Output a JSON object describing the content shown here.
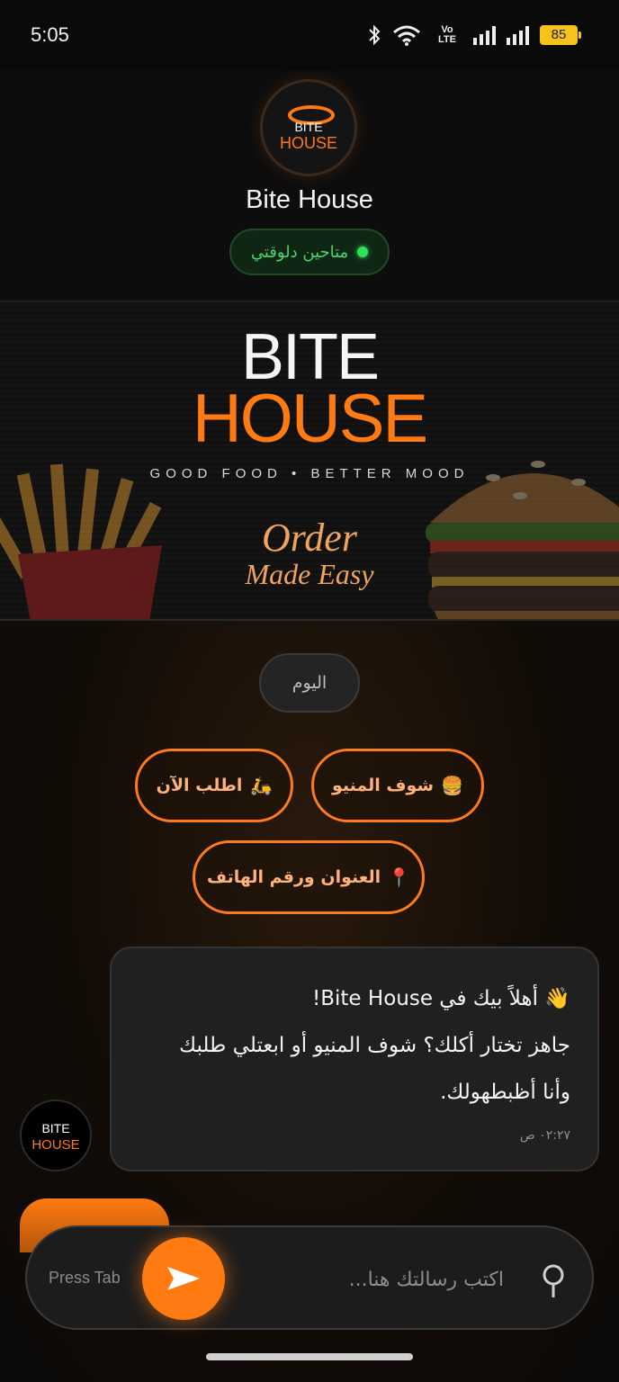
{
  "status_bar": {
    "time": "5:05",
    "network_label": "Vo LTE",
    "battery": "85"
  },
  "header": {
    "logo_top": "BITE",
    "logo_bottom": "HOUSE",
    "name": "Bite House",
    "online_status": "متاحين دلوقتي"
  },
  "banner": {
    "title_top": "BITE",
    "title_bottom": "HOUSE",
    "tagline": "GOOD FOOD • BETTER MOOD",
    "script_line1": "Order",
    "script_line2": "Made Easy"
  },
  "chat": {
    "date_label": "اليوم",
    "quick_replies": [
      {
        "label": "شوف المنيو",
        "icon": "🍔"
      },
      {
        "label": "اطلب الآن",
        "icon": "🛵"
      },
      {
        "label": "العنوان ورقم الهاتف",
        "icon": "📍"
      }
    ],
    "bot_avatar_top": "BITE",
    "bot_avatar_bottom": "HOUSE",
    "message": {
      "line1": "👋 أهلاً بيك في Bite House!",
      "line2": "جاهز تختار أكلك؟ شوف المنيو أو ابعتلي طلبك",
      "line3": "وأنا أظبطهولك.",
      "time": "٠٢:٢٧ ص"
    }
  },
  "input": {
    "press_tab": "Press Tab",
    "placeholder": "اكتب رسالتك هنا..."
  },
  "colors": {
    "accent": "#ff7a10",
    "online": "#2ee05a",
    "background": "#0c0c0c"
  }
}
